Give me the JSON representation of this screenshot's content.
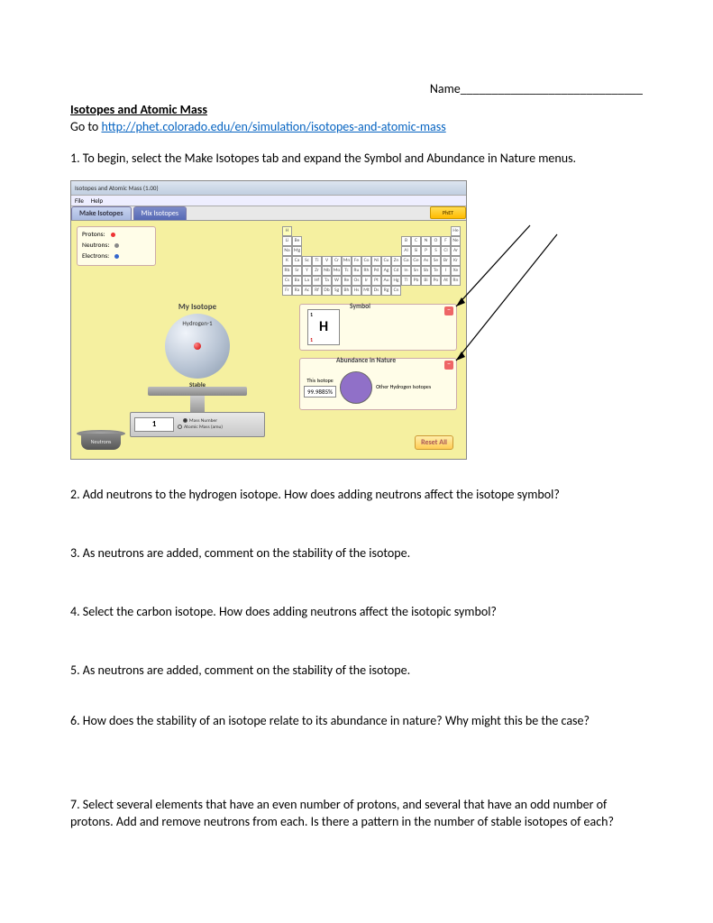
{
  "header": {
    "name_label": "Name",
    "name_blank": "_____________________________",
    "title": "Isotopes and Atomic Mass",
    "goto_prefix": "Go to ",
    "link_text": "http://phet.colorado.edu/en/simulation/isotopes-and-atomic-mass"
  },
  "questions": {
    "q1": "1.  To begin, select the Make Isotopes tab and expand the Symbol and Abundance in Nature menus.",
    "q2": "2.  Add neutrons to the hydrogen isotope.  How does adding neutrons affect the isotope symbol?",
    "q3": "3.  As neutrons are added, comment on the stability of the isotope.",
    "q4": "4.  Select the carbon isotope.  How does adding neutrons affect the isotopic symbol?",
    "q5": "5.  As neutrons are added, comment on the stability of the isotope.",
    "q6": "6. How does the stability of an isotope relate to its abundance in nature?  Why might this be the case?",
    "q7": "7.  Select several elements that have an even number of protons, and several that have an odd number of protons. Add and remove neutrons from each.  Is there a pattern in the number of stable isotopes of each?"
  },
  "sim": {
    "window_title": "Isotopes and Atomic Mass (1.00)",
    "menu": {
      "file": "File",
      "help": "Help"
    },
    "tabs": {
      "make": "Make Isotopes",
      "mix": "Mix Isotopes"
    },
    "phet_logo": "PhET",
    "particles": {
      "protons": "Protons:",
      "neutrons": "Neutrons:",
      "electrons": "Electrons:"
    },
    "periodic_table": {
      "row1": [
        "H",
        "",
        "",
        "",
        "",
        "",
        "",
        "",
        "",
        "",
        "",
        "",
        "",
        "",
        "",
        "",
        "",
        "He"
      ],
      "row2": [
        "Li",
        "Be",
        "",
        "",
        "",
        "",
        "",
        "",
        "",
        "",
        "",
        "",
        "B",
        "C",
        "N",
        "O",
        "F",
        "Ne"
      ],
      "row3": [
        "Na",
        "Mg",
        "",
        "",
        "",
        "",
        "",
        "",
        "",
        "",
        "",
        "",
        "Al",
        "Si",
        "P",
        "S",
        "Cl",
        "Ar"
      ],
      "row4": [
        "K",
        "Ca",
        "Sc",
        "Ti",
        "V",
        "Cr",
        "Mn",
        "Fe",
        "Co",
        "Ni",
        "Cu",
        "Zn",
        "Ga",
        "Ge",
        "As",
        "Se",
        "Br",
        "Kr"
      ],
      "row5": [
        "Rb",
        "Sr",
        "Y",
        "Zr",
        "Nb",
        "Mo",
        "Tc",
        "Ru",
        "Rh",
        "Pd",
        "Ag",
        "Cd",
        "In",
        "Sn",
        "Sb",
        "Te",
        "I",
        "Xe"
      ],
      "row6": [
        "Cs",
        "Ba",
        "La",
        "Hf",
        "Ta",
        "W",
        "Re",
        "Os",
        "Ir",
        "Pt",
        "Au",
        "Hg",
        "Tl",
        "Pb",
        "Bi",
        "Po",
        "At",
        "Rn"
      ],
      "row7": [
        "Fr",
        "Ra",
        "Ac",
        "Rf",
        "Db",
        "Sg",
        "Bh",
        "Hs",
        "Mt",
        "Ds",
        "Rg",
        "Cn",
        "",
        "",
        "",
        "",
        "",
        ""
      ]
    },
    "isotope": {
      "title": "My Isotope",
      "name": "Hydrogen-1",
      "stability": "Stable"
    },
    "scale": {
      "value": "1",
      "opt_mass_number": "Mass Number",
      "opt_atomic_mass": "Atomic Mass (amu)"
    },
    "bucket": "Neutrons",
    "symbol_panel": {
      "header": "Symbol",
      "element": "H",
      "mass_number": "1",
      "atomic_number": "1"
    },
    "abundance_panel": {
      "header": "Abundance in Nature",
      "this_label": "This Isotope",
      "value": "99.9885%",
      "other_label": "Other Hydrogen Isotopes"
    },
    "reset": "Reset All"
  }
}
